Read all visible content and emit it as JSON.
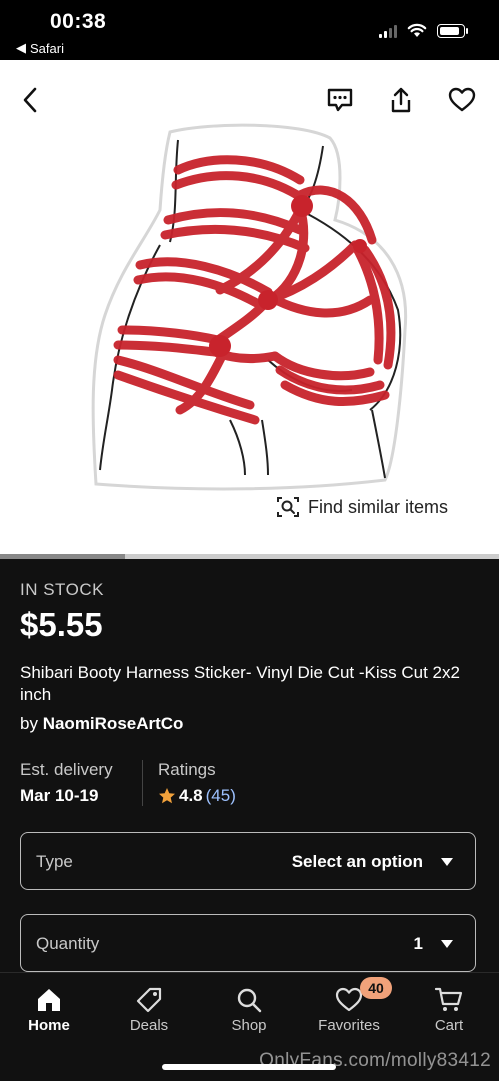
{
  "status_bar": {
    "time": "00:38",
    "back_app": "Safari"
  },
  "product": {
    "stock_status": "IN STOCK",
    "price": "$5.55",
    "title": "Shibari Booty Harness Sticker- Vinyl Die Cut -Kiss Cut 2x2 inch",
    "by_prefix": "by",
    "seller": "NaomiRoseArtCo",
    "est_delivery_label": "Est. delivery",
    "est_delivery_value": "Mar 10-19",
    "ratings_label": "Ratings",
    "rating_value": "4.8",
    "rating_count": "(45)"
  },
  "image_actions": {
    "find_similar": "Find similar items"
  },
  "type_select": {
    "label": "Type",
    "value": "Select an option"
  },
  "quantity_select": {
    "label": "Quantity",
    "value": "1"
  },
  "tabs": [
    {
      "label": "Home",
      "icon": "home-icon"
    },
    {
      "label": "Deals",
      "icon": "tag-icon"
    },
    {
      "label": "Shop",
      "icon": "search-icon"
    },
    {
      "label": "Favorites",
      "icon": "heart-icon"
    },
    {
      "label": "Cart",
      "icon": "cart-icon"
    }
  ],
  "favorites_badge": "40",
  "watermark": "OnlyFans.com/molly83412",
  "colors": {
    "rope": "#c8232c",
    "badge": "#f1a27a",
    "rating_star": "#f1a13b",
    "link": "#9ec2ff"
  }
}
